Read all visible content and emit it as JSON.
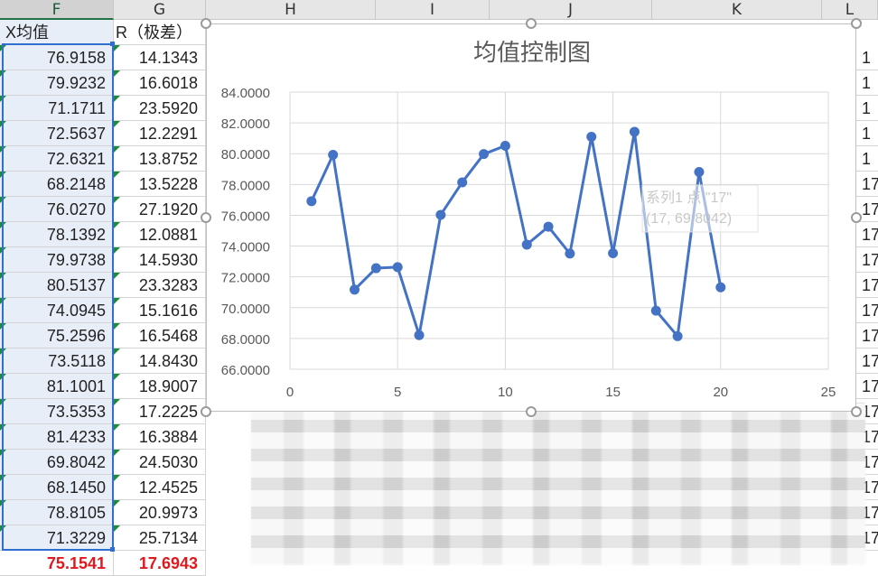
{
  "columns": [
    "F",
    "G",
    "H",
    "I",
    "J",
    "K",
    "L"
  ],
  "headers": {
    "mean": "X均值",
    "range": "R（极差）"
  },
  "means": [
    "76.9158",
    "79.9232",
    "71.1711",
    "72.5637",
    "72.6321",
    "68.2148",
    "76.0270",
    "78.1392",
    "79.9738",
    "80.5137",
    "74.0945",
    "75.2596",
    "73.5118",
    "81.1001",
    "73.5353",
    "81.4233",
    "69.8042",
    "68.1450",
    "78.8105",
    "71.3229"
  ],
  "ranges": [
    "14.1343",
    "16.6018",
    "23.5920",
    "12.2291",
    "13.8752",
    "13.5228",
    "27.1920",
    "12.0881",
    "14.5930",
    "23.3283",
    "15.1616",
    "16.5468",
    "14.8430",
    "18.9007",
    "17.2225",
    "16.3884",
    "24.5030",
    "12.4525",
    "20.9973",
    "25.7134"
  ],
  "totals": {
    "mean": "75.1541",
    "range": "17.6943"
  },
  "right_col": [
    "1",
    "1",
    "1",
    "1",
    "1",
    "17",
    "17",
    "17",
    "17",
    "17",
    "17",
    "17",
    "17",
    "17",
    "17",
    "17",
    "17",
    "17",
    "17",
    "17",
    "17"
  ],
  "chart_data": {
    "type": "scatter",
    "title": "均值控制图",
    "x": [
      1,
      2,
      3,
      4,
      5,
      6,
      7,
      8,
      9,
      10,
      11,
      12,
      13,
      14,
      15,
      16,
      17,
      18,
      19,
      20
    ],
    "y": [
      76.9158,
      79.9232,
      71.1711,
      72.5637,
      72.6321,
      68.2148,
      76.027,
      78.1392,
      79.9738,
      80.5137,
      74.0945,
      75.2596,
      73.5118,
      81.1001,
      73.5353,
      81.4233,
      69.8042,
      68.145,
      78.8105,
      71.3229
    ],
    "xlim": [
      0,
      25
    ],
    "ylim": [
      66,
      84
    ],
    "xticks": [
      "0",
      "5",
      "10",
      "15",
      "20",
      "25"
    ],
    "yticks": [
      "66.0000",
      "68.0000",
      "70.0000",
      "72.0000",
      "74.0000",
      "76.0000",
      "78.0000",
      "80.0000",
      "82.0000",
      "84.0000"
    ],
    "grid": true,
    "color": "#4472c4",
    "tooltip": {
      "line1": "系列1 点 \"17\"",
      "line2": "(17, 69.8042)"
    }
  }
}
